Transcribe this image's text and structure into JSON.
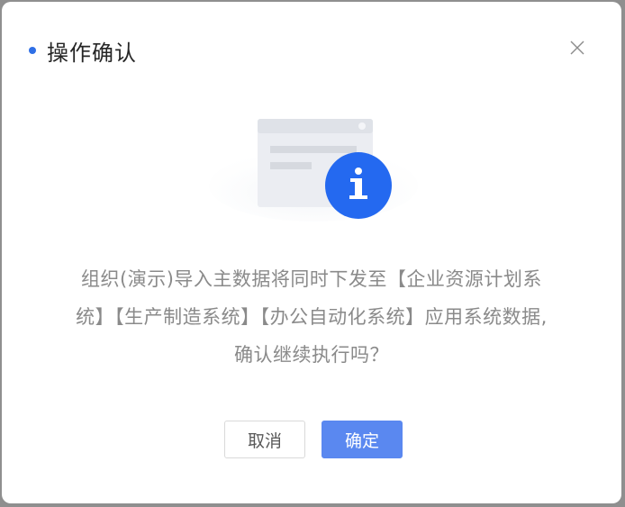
{
  "dialog": {
    "title": "操作确认",
    "message_lines": [
      "组织(演示)导入主数据将同时下发至【企业资源计划系",
      "统】【生产制造系统】【办公自动化系统】应用系统数据,",
      "确认继续执行吗？"
    ],
    "cancel_label": "取消",
    "confirm_label": "确定",
    "close_icon": "close-icon",
    "info_icon": "info-icon"
  },
  "colors": {
    "accent": "#2f6fe6",
    "confirm_button": "#5a88f0",
    "message_text": "#8a8a8a",
    "title_text": "#262626"
  }
}
